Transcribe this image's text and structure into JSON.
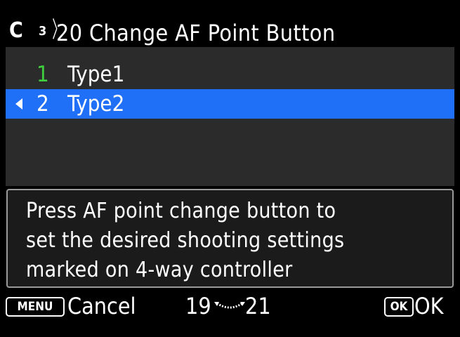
{
  "header": {
    "mode_icon": "C",
    "page_number": "3",
    "title": "20 Change AF Point Button"
  },
  "options": [
    {
      "number": "1",
      "label": "Type1",
      "current": true,
      "selected": false
    },
    {
      "number": "2",
      "label": "Type2",
      "current": false,
      "selected": true
    }
  ],
  "help": {
    "lines": [
      "Press AF point change button to",
      "set the desired shooting settings",
      "marked on 4-way controller"
    ]
  },
  "footer": {
    "menu_key": "MENU",
    "cancel_label": "Cancel",
    "range_start": "19",
    "range_end": "21",
    "ok_key": "OK",
    "ok_label": "OK"
  },
  "colors": {
    "selection": "#1f6ff7",
    "current_marker": "#3fcf3f",
    "panel": "#2b2b2b"
  }
}
